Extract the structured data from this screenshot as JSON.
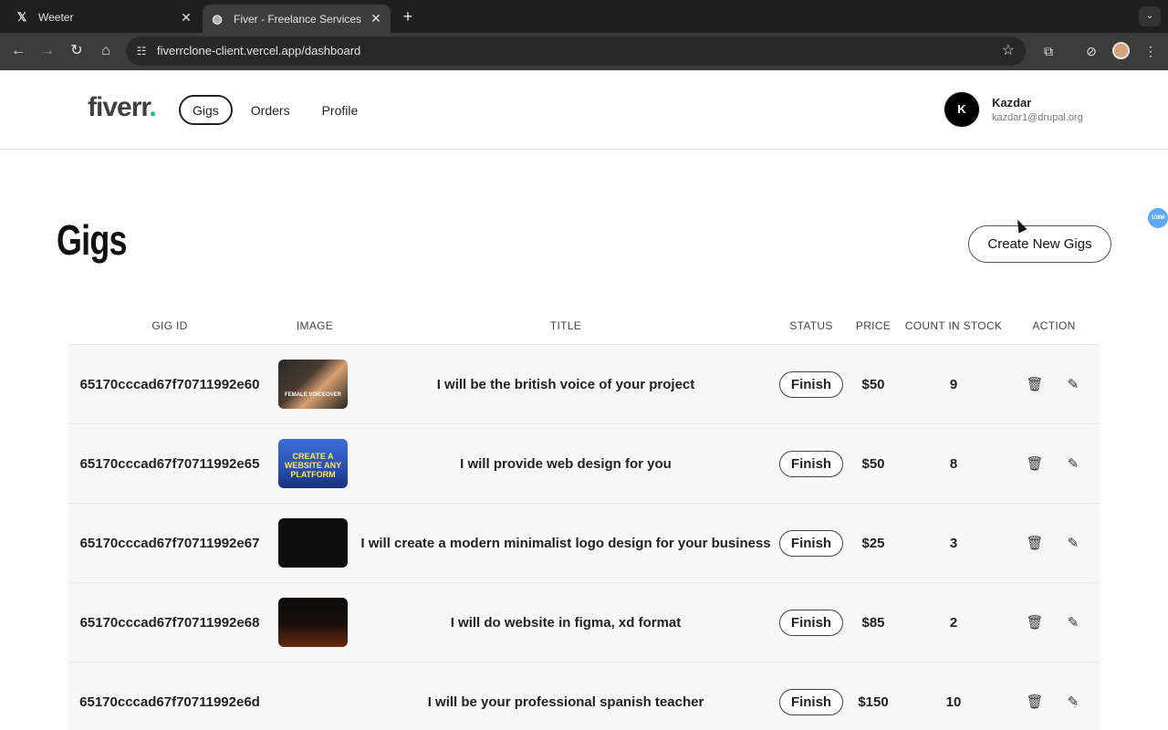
{
  "browser": {
    "tabs": [
      {
        "title": "Weeter",
        "icon": "x-logo-icon"
      },
      {
        "title": "Fiver - Freelance Services Ma",
        "icon": "globe-icon"
      }
    ],
    "url_host": "fiverrclone-client.vercel.app",
    "url_path": "/dashboard"
  },
  "header": {
    "logo_text": "fiverr",
    "logo_dot": ".",
    "nav": [
      "Gigs",
      "Orders",
      "Profile"
    ],
    "active_nav": "Gigs",
    "user": {
      "initial": "K",
      "name": "Kazdar",
      "email": "kazdar1@drupal.org"
    }
  },
  "page": {
    "title": "Gigs",
    "create_label": "Create New Gigs",
    "extension_badge": "108M"
  },
  "table": {
    "columns": [
      "GIG ID",
      "IMAGE",
      "TITLE",
      "STATUS",
      "PRICE",
      "COUNT IN STOCK",
      "ACTION"
    ],
    "rows": [
      {
        "id": "65170cccad67f70711992e60",
        "title": "I will be the british voice of your project",
        "status": "Finish",
        "price": "$50",
        "count": "9",
        "thumb_text": "FEMALE VOICEOVER"
      },
      {
        "id": "65170cccad67f70711992e65",
        "title": "I will provide web design for you",
        "status": "Finish",
        "price": "$50",
        "count": "8",
        "thumb_text": "CREATE A WEBSITE ANY PLATFORM"
      },
      {
        "id": "65170cccad67f70711992e67",
        "title": "I will create a modern minimalist logo design for your business",
        "status": "Finish",
        "price": "$25",
        "count": "3",
        "thumb_text": ""
      },
      {
        "id": "65170cccad67f70711992e68",
        "title": "I will do website in figma, xd format",
        "status": "Finish",
        "price": "$85",
        "count": "2",
        "thumb_text": ""
      },
      {
        "id": "65170cccad67f70711992e6d",
        "title": "I will be your professional spanish teacher",
        "status": "Finish",
        "price": "$150",
        "count": "10",
        "thumb_text": ""
      }
    ]
  }
}
